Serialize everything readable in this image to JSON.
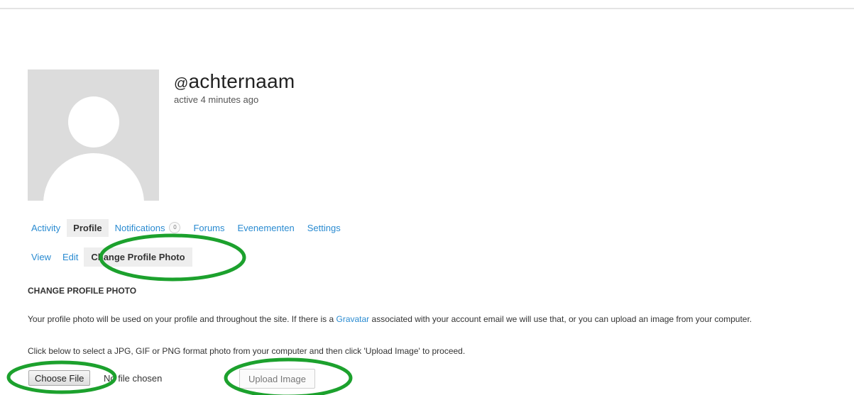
{
  "header": {
    "handle_at": "@",
    "handle": "achternaam",
    "status": "active 4 minutes ago"
  },
  "avatar": {
    "icon": "default-person-silhouette"
  },
  "nav": {
    "items": [
      {
        "label": "Activity"
      },
      {
        "label": "Profile"
      },
      {
        "label": "Notifications",
        "count": "0"
      },
      {
        "label": "Forums"
      },
      {
        "label": "Evenementen"
      },
      {
        "label": "Settings"
      }
    ],
    "current": "Profile"
  },
  "subnav": {
    "items": [
      {
        "label": "View"
      },
      {
        "label": "Edit"
      },
      {
        "label": "Change Profile Photo"
      }
    ],
    "current": "Change Profile Photo"
  },
  "section": {
    "title": "CHANGE PROFILE PHOTO",
    "description_before": "Your profile photo will be used on your profile and throughout the site. If there is a ",
    "description_link": "Gravatar",
    "description_after": " associated with your account email we will use that, or you can upload an image from your computer.",
    "instruction": "Click below to select a JPG, GIF or PNG format photo from your computer and then click 'Upload Image' to proceed."
  },
  "upload": {
    "choose_file_label": "Choose File",
    "file_status": "No file chosen",
    "upload_label": "Upload Image"
  },
  "colors": {
    "link": "#2a8bd1",
    "annotation": "#1ca12d",
    "current_tab_bg": "#eeeeee"
  }
}
